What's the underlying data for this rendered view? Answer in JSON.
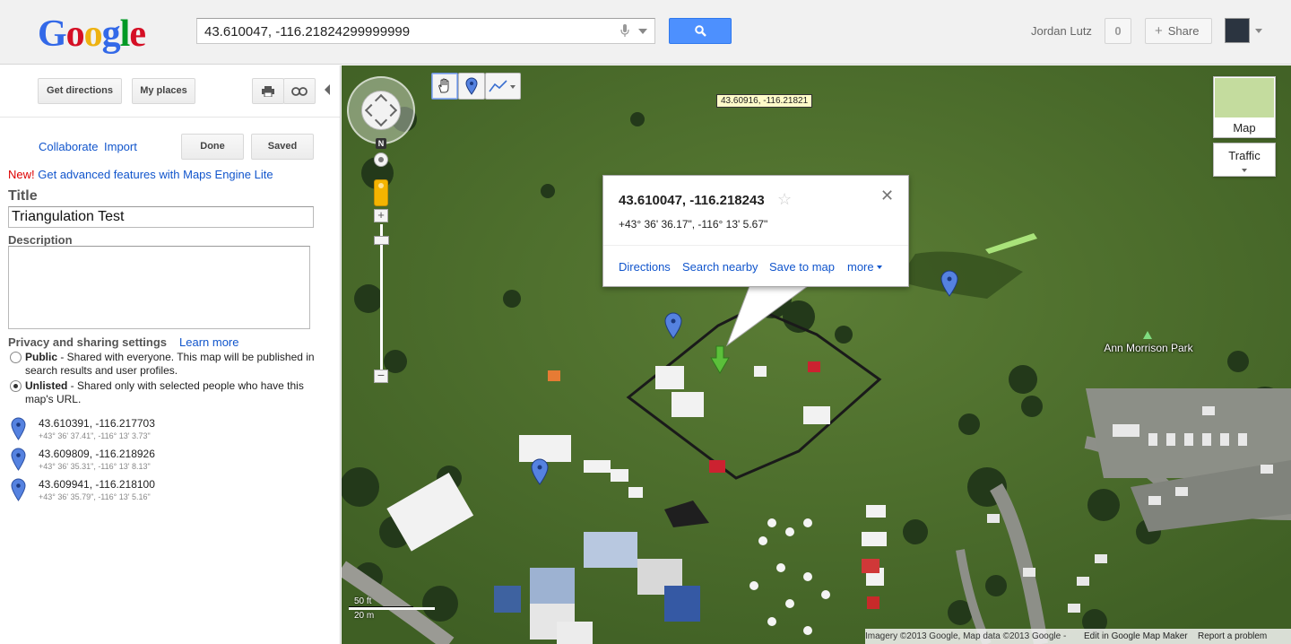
{
  "logo": {
    "letters": [
      "G",
      "o",
      "o",
      "g",
      "l",
      "e"
    ]
  },
  "search": {
    "value": "43.610047, -116.21824299999999"
  },
  "user": {
    "name": "Jordan Lutz",
    "notifications": "0",
    "share_label": "Share"
  },
  "panel": {
    "get_directions": "Get directions",
    "my_places": "My places",
    "collaborate": "Collaborate",
    "import": "Import",
    "done": "Done",
    "saved": "Saved",
    "promo_new": "New!",
    "promo_text": "Get advanced features with Maps Engine Lite",
    "title_label": "Title",
    "title_value": "Triangulation Test",
    "description_label": "Description",
    "privacy_label": "Privacy and sharing settings",
    "learn_more": "Learn more",
    "public_bold": "Public",
    "public_text": " - Shared with everyone. This map will be published in search results and user profiles.",
    "unlisted_bold": "Unlisted",
    "unlisted_text": " - Shared only with selected people who have this map's URL.",
    "selected_privacy": "Unlisted",
    "places": [
      {
        "coord": "43.610391, -116.217703",
        "dms": "+43° 36' 37.41\", -116° 13' 3.73\""
      },
      {
        "coord": "43.609809, -116.218926",
        "dms": "+43° 36' 35.31\", -116° 13' 8.13\""
      },
      {
        "coord": "43.609941, -116.218100",
        "dms": "+43° 36' 35.79\", -116° 13' 5.16\""
      }
    ]
  },
  "map": {
    "tooltip": "43.60916, -116.21821",
    "north": "N",
    "map_type": "Map",
    "traffic": "Traffic",
    "park_name": "Ann Morrison Park",
    "scale_ft": "50 ft",
    "scale_m": "20 m",
    "attribution": "Imagery ©2013 Google, Map data ©2013 Google -",
    "edit_link": "Edit in Google Map Maker",
    "report_link": "Report a problem",
    "infowindow": {
      "title": "43.610047, -116.218243",
      "dms": "+43° 36' 36.17\", -116° 13' 5.67\"",
      "directions": "Directions",
      "search_nearby": "Search nearby",
      "save_to_map": "Save to map",
      "more": "more"
    }
  },
  "colors": {
    "accent": "#4d90fe",
    "link": "#1155cc",
    "new_red": "#dd0000",
    "grass": "#4a6b2c"
  }
}
